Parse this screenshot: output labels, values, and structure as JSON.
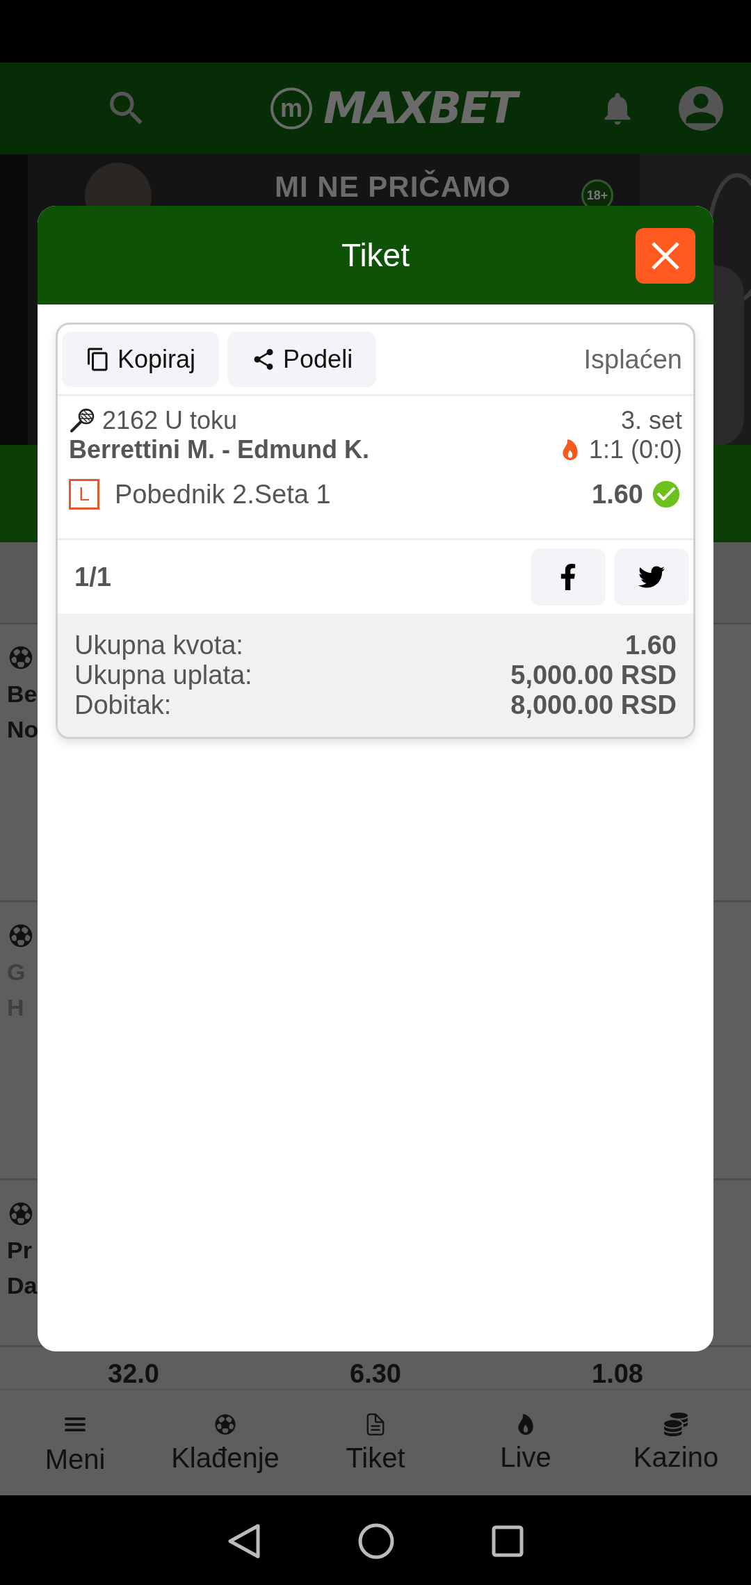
{
  "header": {
    "logo_mark": "m",
    "logo": "MAXBET"
  },
  "banner": {
    "title": "MI NE PRIČAMO",
    "badge": "18+"
  },
  "background_matches": [
    {
      "line_1": "Be",
      "line_2": "No",
      "muted": false
    },
    {
      "line_1": "G",
      "line_2": "H",
      "muted": true
    },
    {
      "line_1": "Pr",
      "line_2": "Da",
      "muted": false
    }
  ],
  "odds": [
    "32.0",
    "6.30",
    "1.08"
  ],
  "bottom_nav": [
    {
      "label": "Meni",
      "kind": "menu"
    },
    {
      "label": "Klađenje",
      "kind": "ball"
    },
    {
      "label": "Tiket",
      "kind": "ticket"
    },
    {
      "label": "Live",
      "kind": "fire"
    },
    {
      "label": "Kazino",
      "kind": "chip"
    }
  ],
  "modal": {
    "title": "Tiket",
    "actions": [
      {
        "label": "Kopiraj",
        "kind": "copy"
      },
      {
        "label": "Podeli",
        "kind": "share"
      }
    ],
    "status": "Isplaćen",
    "events": [
      {
        "info": "2162 U toku",
        "period": "3. set",
        "match": "Berrettini M. - Edmund K.",
        "live": true,
        "score": "1:1 (0:0)",
        "badge": "L",
        "pick": "Pobednik 2.Seta 1",
        "odd": "1.60",
        "won": true
      }
    ],
    "count": "1/1",
    "totals": [
      {
        "label": "Ukupna kvota:",
        "value": "1.60"
      },
      {
        "label": "Ukupna uplata:",
        "value": "5,000.00 RSD"
      },
      {
        "label": "Dobitak:",
        "value": "8,000.00 RSD"
      }
    ]
  }
}
